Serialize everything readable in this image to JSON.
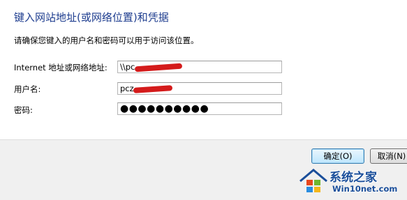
{
  "dialog": {
    "title": "键入网站地址(或网络位置)和凭据",
    "instruction": "请确保您键入的用户名和密码可以用于访问该位置。"
  },
  "fields": {
    "address": {
      "label": "Internet 地址或网络地址:",
      "value": "\\\\pc"
    },
    "username": {
      "label": "用户名:",
      "value": "pcz"
    },
    "password": {
      "label": "密码:",
      "value": "●●●●●●●●●●"
    }
  },
  "buttons": {
    "ok": "确定(O)",
    "cancel": "取消(N)"
  },
  "watermark": {
    "brand": "系统之家",
    "url": "Win10net.com",
    "logo_icon": "windows-house-logo-icon"
  },
  "colors": {
    "title": "#1e3d8f",
    "redaction": "#d41b1b",
    "footer": "#f0f0f0",
    "watermark": "#1a4e9a"
  }
}
